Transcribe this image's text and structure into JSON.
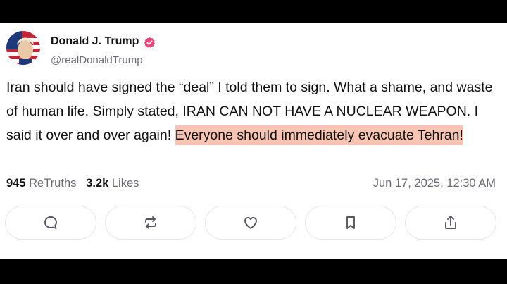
{
  "post": {
    "author_name": "Donald J. Trump",
    "handle": "@realDonaldTrump",
    "text_plain": "Iran should have signed the “deal” I told them to sign. What a shame, and waste of human life. Simply stated, IRAN CAN NOT HAVE A NUCLEAR WEAPON. I said it over and over again! ",
    "text_highlighted": "Everyone should immediately evacuate Tehran!",
    "highlight_color": "#f9c4b3",
    "retruths_count": "945",
    "retruths_label": "ReTruths",
    "likes_count": "3.2k",
    "likes_label": "Likes",
    "timestamp": "Jun 17, 2025, 12:30 AM"
  },
  "actions": [
    {
      "icon": "comment-icon"
    },
    {
      "icon": "retruth-icon"
    },
    {
      "icon": "heart-icon"
    },
    {
      "icon": "bookmark-icon"
    },
    {
      "icon": "share-icon"
    }
  ],
  "colors": {
    "verified_badge": "#e8457a",
    "secondary_text": "#6b6b73",
    "border": "#e6e6ea"
  }
}
